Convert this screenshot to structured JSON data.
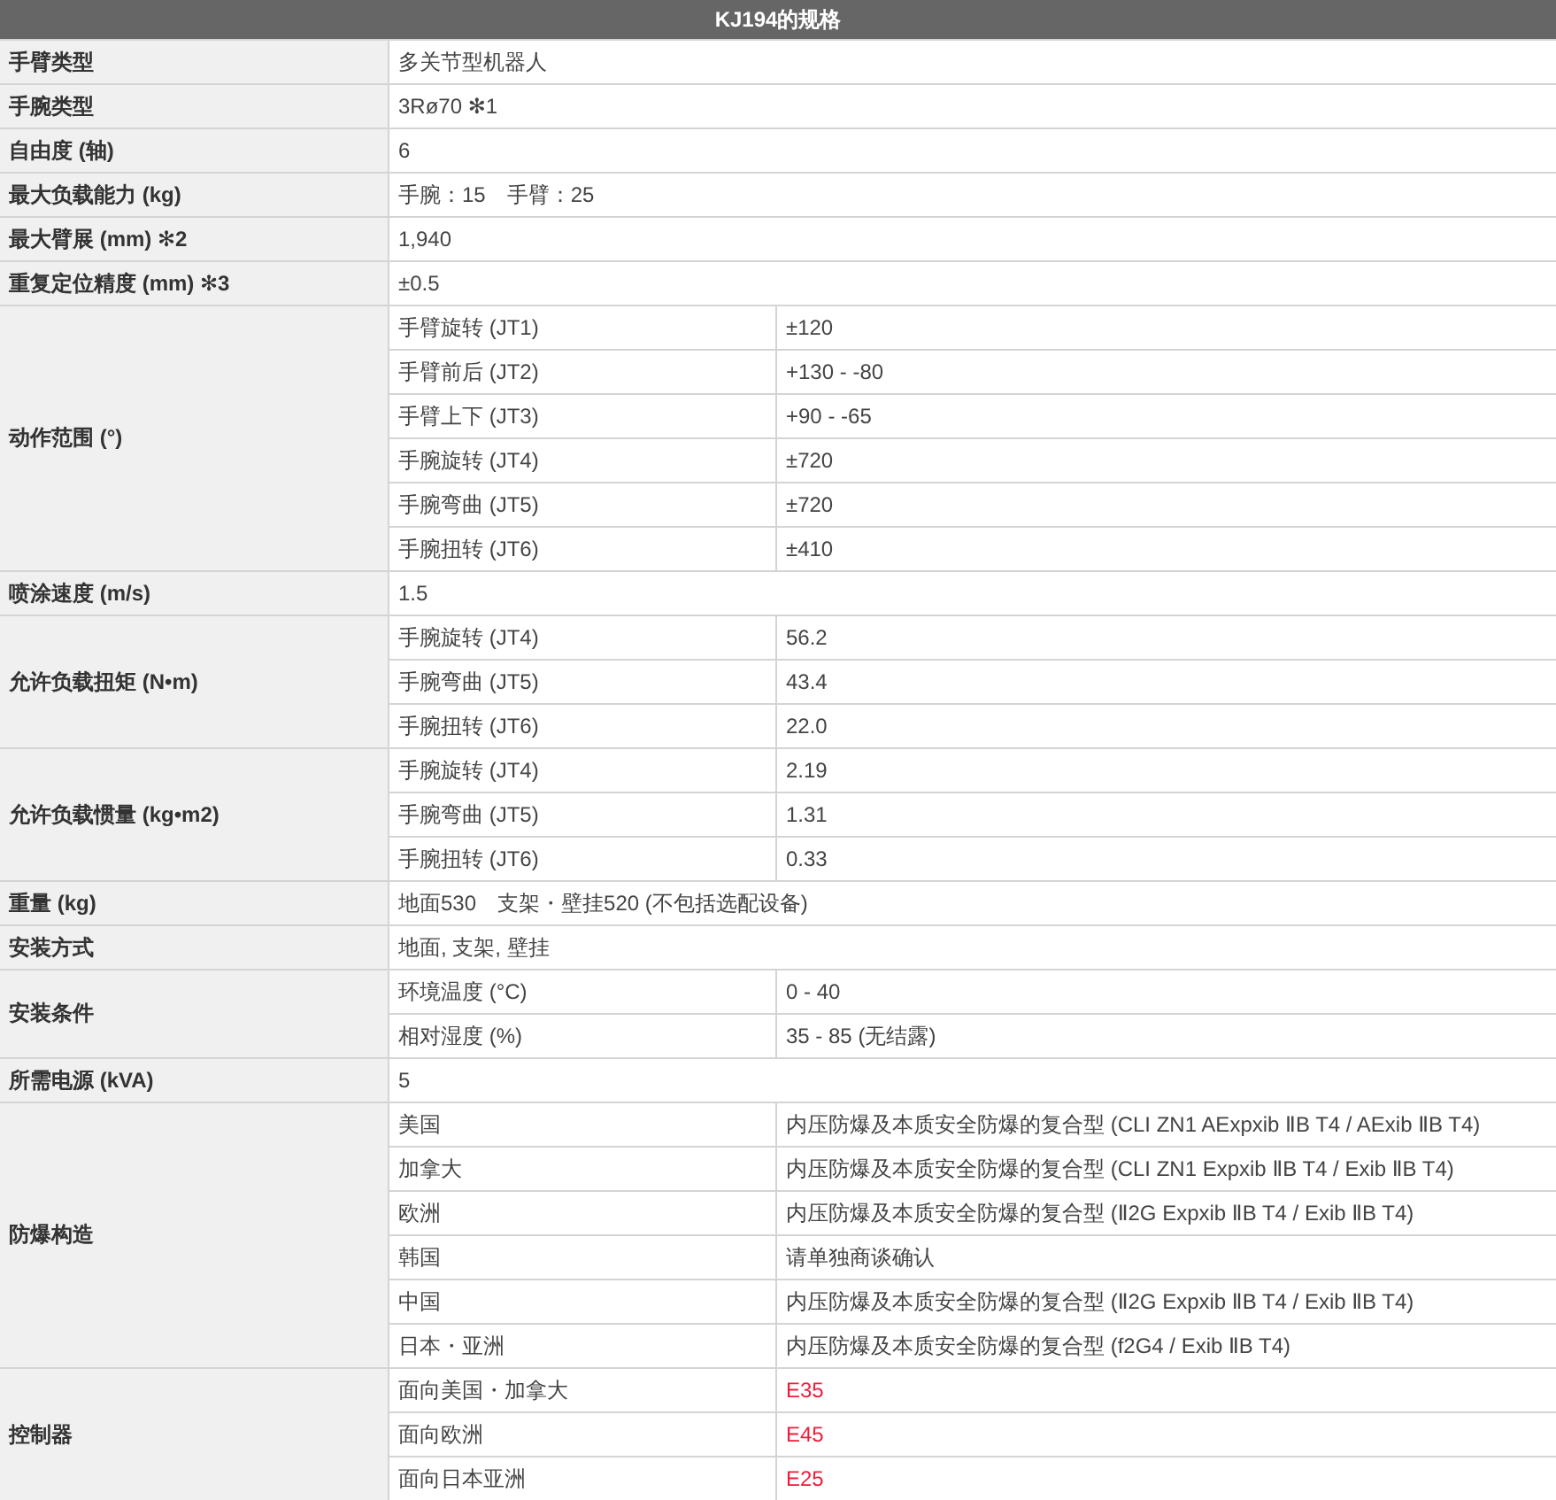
{
  "table": {
    "title": "KJ194的规格",
    "rows": [
      {
        "label": "手臂类型",
        "value": "多关节型机器人"
      },
      {
        "label": "手腕类型",
        "value": "3Rø70 ✻1"
      },
      {
        "label": "自由度 (轴)",
        "value": "6"
      },
      {
        "label": "最大负载能力 (kg)",
        "value": "手腕：15　手臂：25"
      },
      {
        "label": "最大臂展 (mm) ✻2",
        "value": "1,940"
      },
      {
        "label": "重复定位精度 (mm) ✻3",
        "value": "±0.5"
      },
      {
        "label": "动作范围 (°)",
        "items": [
          {
            "name": "手臂旋转 (JT1)",
            "value": "±120"
          },
          {
            "name": "手臂前后 (JT2)",
            "value": "+130 - -80"
          },
          {
            "name": "手臂上下 (JT3)",
            "value": "+90 - -65"
          },
          {
            "name": "手腕旋转 (JT4)",
            "value": "±720"
          },
          {
            "name": "手腕弯曲 (JT5)",
            "value": "±720"
          },
          {
            "name": "手腕扭转 (JT6)",
            "value": "±410"
          }
        ]
      },
      {
        "label": "喷涂速度 (m/s)",
        "value": "1.5"
      },
      {
        "label": "允许负载扭矩 (N•m)",
        "items": [
          {
            "name": "手腕旋转 (JT4)",
            "value": "56.2"
          },
          {
            "name": "手腕弯曲 (JT5)",
            "value": "43.4"
          },
          {
            "name": "手腕扭转 (JT6)",
            "value": "22.0"
          }
        ]
      },
      {
        "label": "允许负载惯量 (kg•m2)",
        "items": [
          {
            "name": "手腕旋转 (JT4)",
            "value": "2.19"
          },
          {
            "name": "手腕弯曲 (JT5)",
            "value": "1.31"
          },
          {
            "name": "手腕扭转 (JT6)",
            "value": "0.33"
          }
        ]
      },
      {
        "label": "重量 (kg)",
        "value": "地面530　支架・壁挂520 (不包括选配设备)"
      },
      {
        "label": "安装方式",
        "value": "地面, 支架, 壁挂"
      },
      {
        "label": "安装条件",
        "items": [
          {
            "name": "环境温度 (°C)",
            "value": "0 - 40"
          },
          {
            "name": "相对湿度 (%)",
            "value": "35 - 85 (无结露)"
          }
        ]
      },
      {
        "label": "所需电源 (kVA)",
        "value": "5"
      },
      {
        "label": "防爆构造",
        "items": [
          {
            "name": "美国",
            "value": "内压防爆及本质安全防爆的复合型 (CLI ZN1 AExpxib ⅡB T4 / AExib ⅡB T4)"
          },
          {
            "name": "加拿大",
            "value": "内压防爆及本质安全防爆的复合型 (CLI ZN1 Expxib ⅡB T4 / Exib ⅡB T4)"
          },
          {
            "name": "欧洲",
            "value": "内压防爆及本质安全防爆的复合型 (Ⅱ2G Expxib ⅡB T4 / Exib ⅡB T4)"
          },
          {
            "name": "韩国",
            "value": "请单独商谈确认"
          },
          {
            "name": "中国",
            "value": "内压防爆及本质安全防爆的复合型 (Ⅱ2G Expxib ⅡB T4 / Exib ⅡB T4)"
          },
          {
            "name": "日本・亚洲",
            "value": "内压防爆及本质安全防爆的复合型 (f2G4 / Exib ⅡB T4)"
          }
        ]
      },
      {
        "label": "控制器",
        "items": [
          {
            "name": "面向美国・加拿大",
            "value": "E35",
            "color": "#ee1c3a"
          },
          {
            "name": "面向欧洲",
            "value": "E45",
            "color": "#ee1c3a"
          },
          {
            "name": "面向日本亚洲",
            "value": "E25",
            "color": "#ee1c3a"
          }
        ]
      }
    ]
  }
}
